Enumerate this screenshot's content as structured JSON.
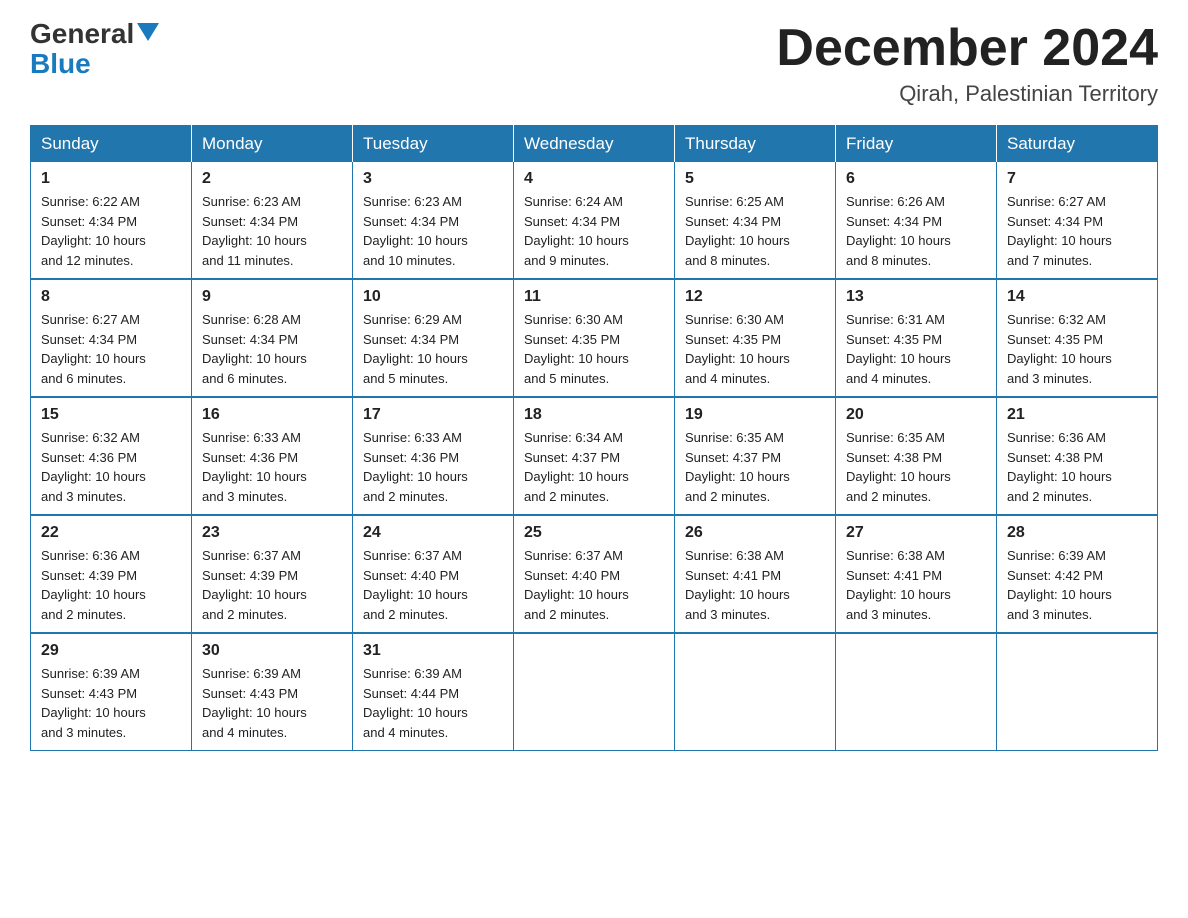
{
  "header": {
    "logo_line1": "General",
    "logo_line2": "Blue",
    "title": "December 2024",
    "subtitle": "Qirah, Palestinian Territory"
  },
  "days_of_week": [
    "Sunday",
    "Monday",
    "Tuesday",
    "Wednesday",
    "Thursday",
    "Friday",
    "Saturday"
  ],
  "weeks": [
    [
      {
        "day": "1",
        "sunrise": "6:22 AM",
        "sunset": "4:34 PM",
        "daylight": "10 hours and 12 minutes."
      },
      {
        "day": "2",
        "sunrise": "6:23 AM",
        "sunset": "4:34 PM",
        "daylight": "10 hours and 11 minutes."
      },
      {
        "day": "3",
        "sunrise": "6:23 AM",
        "sunset": "4:34 PM",
        "daylight": "10 hours and 10 minutes."
      },
      {
        "day": "4",
        "sunrise": "6:24 AM",
        "sunset": "4:34 PM",
        "daylight": "10 hours and 9 minutes."
      },
      {
        "day": "5",
        "sunrise": "6:25 AM",
        "sunset": "4:34 PM",
        "daylight": "10 hours and 8 minutes."
      },
      {
        "day": "6",
        "sunrise": "6:26 AM",
        "sunset": "4:34 PM",
        "daylight": "10 hours and 8 minutes."
      },
      {
        "day": "7",
        "sunrise": "6:27 AM",
        "sunset": "4:34 PM",
        "daylight": "10 hours and 7 minutes."
      }
    ],
    [
      {
        "day": "8",
        "sunrise": "6:27 AM",
        "sunset": "4:34 PM",
        "daylight": "10 hours and 6 minutes."
      },
      {
        "day": "9",
        "sunrise": "6:28 AM",
        "sunset": "4:34 PM",
        "daylight": "10 hours and 6 minutes."
      },
      {
        "day": "10",
        "sunrise": "6:29 AM",
        "sunset": "4:34 PM",
        "daylight": "10 hours and 5 minutes."
      },
      {
        "day": "11",
        "sunrise": "6:30 AM",
        "sunset": "4:35 PM",
        "daylight": "10 hours and 5 minutes."
      },
      {
        "day": "12",
        "sunrise": "6:30 AM",
        "sunset": "4:35 PM",
        "daylight": "10 hours and 4 minutes."
      },
      {
        "day": "13",
        "sunrise": "6:31 AM",
        "sunset": "4:35 PM",
        "daylight": "10 hours and 4 minutes."
      },
      {
        "day": "14",
        "sunrise": "6:32 AM",
        "sunset": "4:35 PM",
        "daylight": "10 hours and 3 minutes."
      }
    ],
    [
      {
        "day": "15",
        "sunrise": "6:32 AM",
        "sunset": "4:36 PM",
        "daylight": "10 hours and 3 minutes."
      },
      {
        "day": "16",
        "sunrise": "6:33 AM",
        "sunset": "4:36 PM",
        "daylight": "10 hours and 3 minutes."
      },
      {
        "day": "17",
        "sunrise": "6:33 AM",
        "sunset": "4:36 PM",
        "daylight": "10 hours and 2 minutes."
      },
      {
        "day": "18",
        "sunrise": "6:34 AM",
        "sunset": "4:37 PM",
        "daylight": "10 hours and 2 minutes."
      },
      {
        "day": "19",
        "sunrise": "6:35 AM",
        "sunset": "4:37 PM",
        "daylight": "10 hours and 2 minutes."
      },
      {
        "day": "20",
        "sunrise": "6:35 AM",
        "sunset": "4:38 PM",
        "daylight": "10 hours and 2 minutes."
      },
      {
        "day": "21",
        "sunrise": "6:36 AM",
        "sunset": "4:38 PM",
        "daylight": "10 hours and 2 minutes."
      }
    ],
    [
      {
        "day": "22",
        "sunrise": "6:36 AM",
        "sunset": "4:39 PM",
        "daylight": "10 hours and 2 minutes."
      },
      {
        "day": "23",
        "sunrise": "6:37 AM",
        "sunset": "4:39 PM",
        "daylight": "10 hours and 2 minutes."
      },
      {
        "day": "24",
        "sunrise": "6:37 AM",
        "sunset": "4:40 PM",
        "daylight": "10 hours and 2 minutes."
      },
      {
        "day": "25",
        "sunrise": "6:37 AM",
        "sunset": "4:40 PM",
        "daylight": "10 hours and 2 minutes."
      },
      {
        "day": "26",
        "sunrise": "6:38 AM",
        "sunset": "4:41 PM",
        "daylight": "10 hours and 3 minutes."
      },
      {
        "day": "27",
        "sunrise": "6:38 AM",
        "sunset": "4:41 PM",
        "daylight": "10 hours and 3 minutes."
      },
      {
        "day": "28",
        "sunrise": "6:39 AM",
        "sunset": "4:42 PM",
        "daylight": "10 hours and 3 minutes."
      }
    ],
    [
      {
        "day": "29",
        "sunrise": "6:39 AM",
        "sunset": "4:43 PM",
        "daylight": "10 hours and 3 minutes."
      },
      {
        "day": "30",
        "sunrise": "6:39 AM",
        "sunset": "4:43 PM",
        "daylight": "10 hours and 4 minutes."
      },
      {
        "day": "31",
        "sunrise": "6:39 AM",
        "sunset": "4:44 PM",
        "daylight": "10 hours and 4 minutes."
      },
      null,
      null,
      null,
      null
    ]
  ],
  "labels": {
    "sunrise": "Sunrise:",
    "sunset": "Sunset:",
    "daylight": "Daylight:"
  }
}
